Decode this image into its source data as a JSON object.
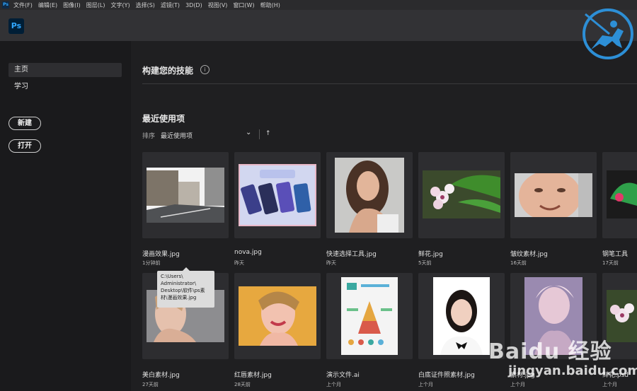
{
  "menubar": {
    "app_badge": "Ps",
    "items": [
      "文件(F)",
      "编辑(E)",
      "图像(I)",
      "图层(L)",
      "文字(Y)",
      "选择(S)",
      "滤镜(T)",
      "3D(D)",
      "视图(V)",
      "窗口(W)",
      "帮助(H)"
    ]
  },
  "app": {
    "logo_text": "Ps",
    "logo_color": "#31a8ff"
  },
  "sidebar": {
    "nav": [
      {
        "label": "主页",
        "active": true
      },
      {
        "label": "学习",
        "active": false
      }
    ],
    "new_label": "新建",
    "open_label": "打开"
  },
  "main": {
    "skills_heading": "构建您的技能",
    "info_icon": "i",
    "recent_heading": "最近使用项",
    "sort_label": "排序",
    "sort_value": "最近使用项",
    "sort_chevron": "⌄",
    "sort_direction_icon": "↑"
  },
  "files": [
    {
      "name": "漫画效果.jpg",
      "time": "1分钟前"
    },
    {
      "name": "nova.jpg",
      "time": "昨天"
    },
    {
      "name": "快速选择工具.jpg",
      "time": "昨天"
    },
    {
      "name": "鲜花.jpg",
      "time": "5天前"
    },
    {
      "name": "皱纹素材.jpg",
      "time": "16天前"
    },
    {
      "name": "钢笔工具",
      "time": "17天前"
    },
    {
      "name": "美白素材.jpg",
      "time": "27天前"
    },
    {
      "name": "红唇素材.jpg",
      "time": "28天前"
    },
    {
      "name": "演示文件.ai",
      "time": "上个月"
    },
    {
      "name": "白底证件照素材.jpg",
      "time": "上个月"
    },
    {
      "name": "素材.jpg",
      "time": "上个月"
    },
    {
      "name": "鲜花.psd",
      "time": "上个月"
    }
  ],
  "tooltip": {
    "text": "C:\\Users\\\nAdministrator\\\nDesktop\\软件\\ps素\n材\\漫画效果.jpg"
  },
  "watermark": {
    "text": "Baidu 经验",
    "url": "jingyan.baidu.com"
  }
}
